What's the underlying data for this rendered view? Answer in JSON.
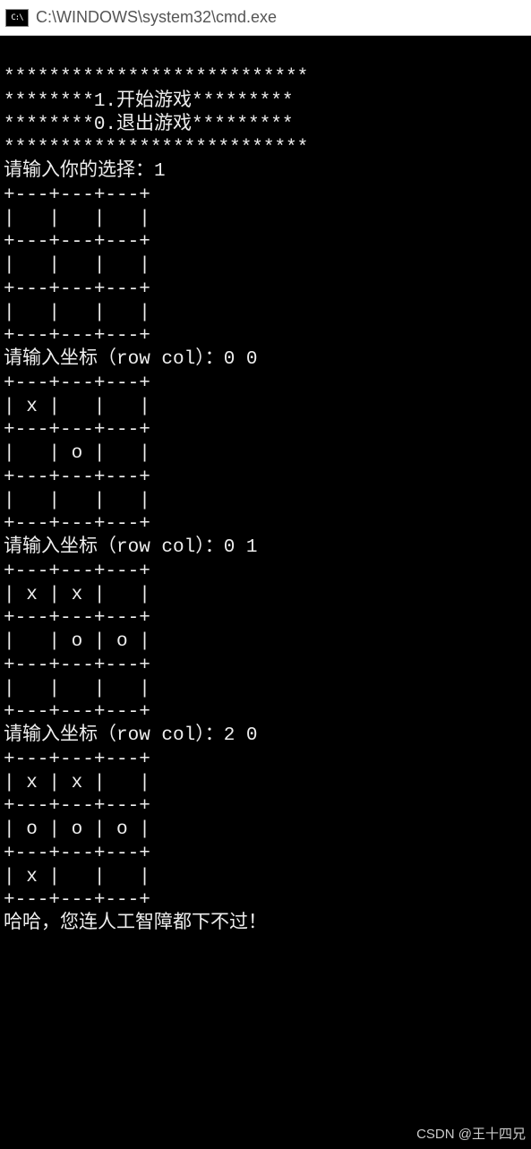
{
  "window": {
    "title": "C:\\WINDOWS\\system32\\cmd.exe"
  },
  "console": {
    "lines": [
      "***************************",
      "********1.开始游戏*********",
      "********0.退出游戏*********",
      "***************************",
      "请输入你的选择：1",
      "+---+---+---+",
      "|   |   |   |",
      "+---+---+---+",
      "|   |   |   |",
      "+---+---+---+",
      "|   |   |   |",
      "+---+---+---+",
      "请输入坐标（row col）：0 0",
      "+---+---+---+",
      "| x |   |   |",
      "+---+---+---+",
      "|   | o |   |",
      "+---+---+---+",
      "|   |   |   |",
      "+---+---+---+",
      "请输入坐标（row col）：0 1",
      "+---+---+---+",
      "| x | x |   |",
      "+---+---+---+",
      "|   | o | o |",
      "+---+---+---+",
      "|   |   |   |",
      "+---+---+---+",
      "请输入坐标（row col）：2 0",
      "+---+---+---+",
      "| x | x |   |",
      "+---+---+---+",
      "| o | o | o |",
      "+---+---+---+",
      "| x |   |   |",
      "+---+---+---+",
      "哈哈，您连人工智障都下不过！"
    ]
  },
  "game": {
    "menu_start": "1.开始游戏",
    "menu_quit": "0.退出游戏",
    "prompt_choice": "请输入你的选择：",
    "choice_value": "1",
    "prompt_coord": "请输入坐标（row col）：",
    "moves": [
      "0 0",
      "0 1",
      "2 0"
    ],
    "lose_message": "哈哈，您连人工智障都下不过！",
    "boards": [
      [
        [
          " ",
          " ",
          " "
        ],
        [
          " ",
          " ",
          " "
        ],
        [
          " ",
          " ",
          " "
        ]
      ],
      [
        [
          "x",
          " ",
          " "
        ],
        [
          " ",
          "o",
          " "
        ],
        [
          " ",
          " ",
          " "
        ]
      ],
      [
        [
          "x",
          "x",
          " "
        ],
        [
          " ",
          "o",
          "o"
        ],
        [
          " ",
          " ",
          " "
        ]
      ],
      [
        [
          "x",
          "x",
          " "
        ],
        [
          "o",
          "o",
          "o"
        ],
        [
          "x",
          " ",
          " "
        ]
      ]
    ]
  },
  "watermark": "CSDN @王十四兄"
}
